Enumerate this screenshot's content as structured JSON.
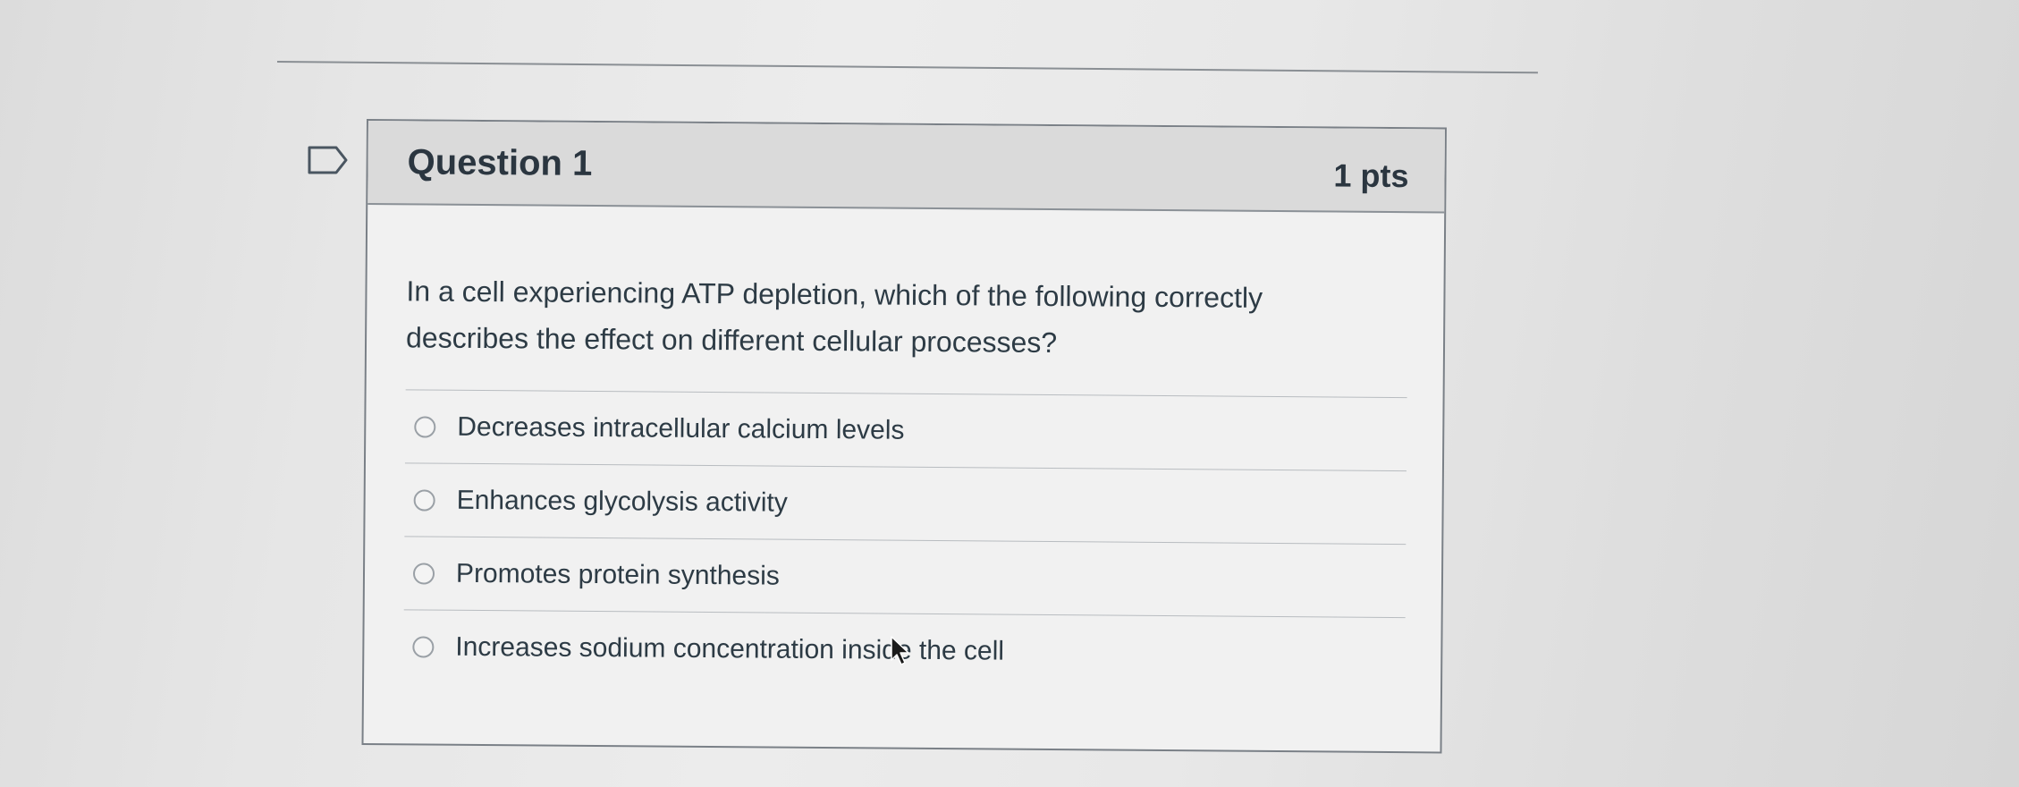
{
  "question": {
    "title": "Question 1",
    "points": "1 pts",
    "text": "In a cell experiencing ATP depletion, which of the following correctly describes the effect on different cellular processes?",
    "answers": [
      {
        "label": "Decreases intracellular calcium levels",
        "selected": false
      },
      {
        "label": "Enhances glycolysis activity",
        "selected": false
      },
      {
        "label": "Promotes protein synthesis",
        "selected": false
      },
      {
        "label": "Increases sodium concentration inside the cell",
        "selected": false
      }
    ]
  },
  "icons": {
    "flag": "flag-icon",
    "radio": "radio-button-icon",
    "cursor": "mouse-pointer-icon"
  },
  "colors": {
    "header_bg": "#dadada",
    "card_bg": "#f1f1f1",
    "text": "#2d3b45",
    "border": "#7a8087"
  }
}
